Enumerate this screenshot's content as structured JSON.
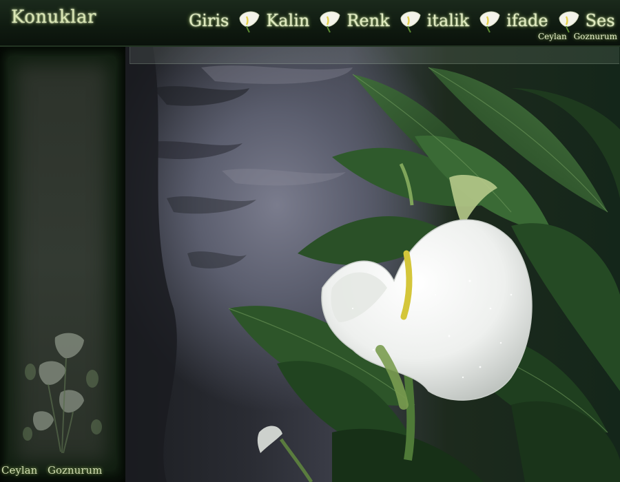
{
  "site": {
    "brand": "Konuklar"
  },
  "menu": {
    "items": [
      {
        "label": "Giris",
        "icon": "calla-lily-icon"
      },
      {
        "label": "Kalin",
        "icon": "calla-lily-icon"
      },
      {
        "label": "Renk",
        "icon": "calla-lily-icon"
      },
      {
        "label": "italik",
        "icon": "calla-lily-icon"
      },
      {
        "label": "ifade",
        "icon": "calla-lily-icon"
      },
      {
        "label": "Ses",
        "icon": "none"
      }
    ]
  },
  "credits": {
    "top": "Ceylan Goznurum",
    "bottom": "Ceylan Goznurum"
  },
  "colors": {
    "nav_text": "#e1ecc0",
    "nav_glow": "#9cbf5a",
    "bar_bg": "#0f1a10",
    "panel_bg": "#333a32"
  }
}
